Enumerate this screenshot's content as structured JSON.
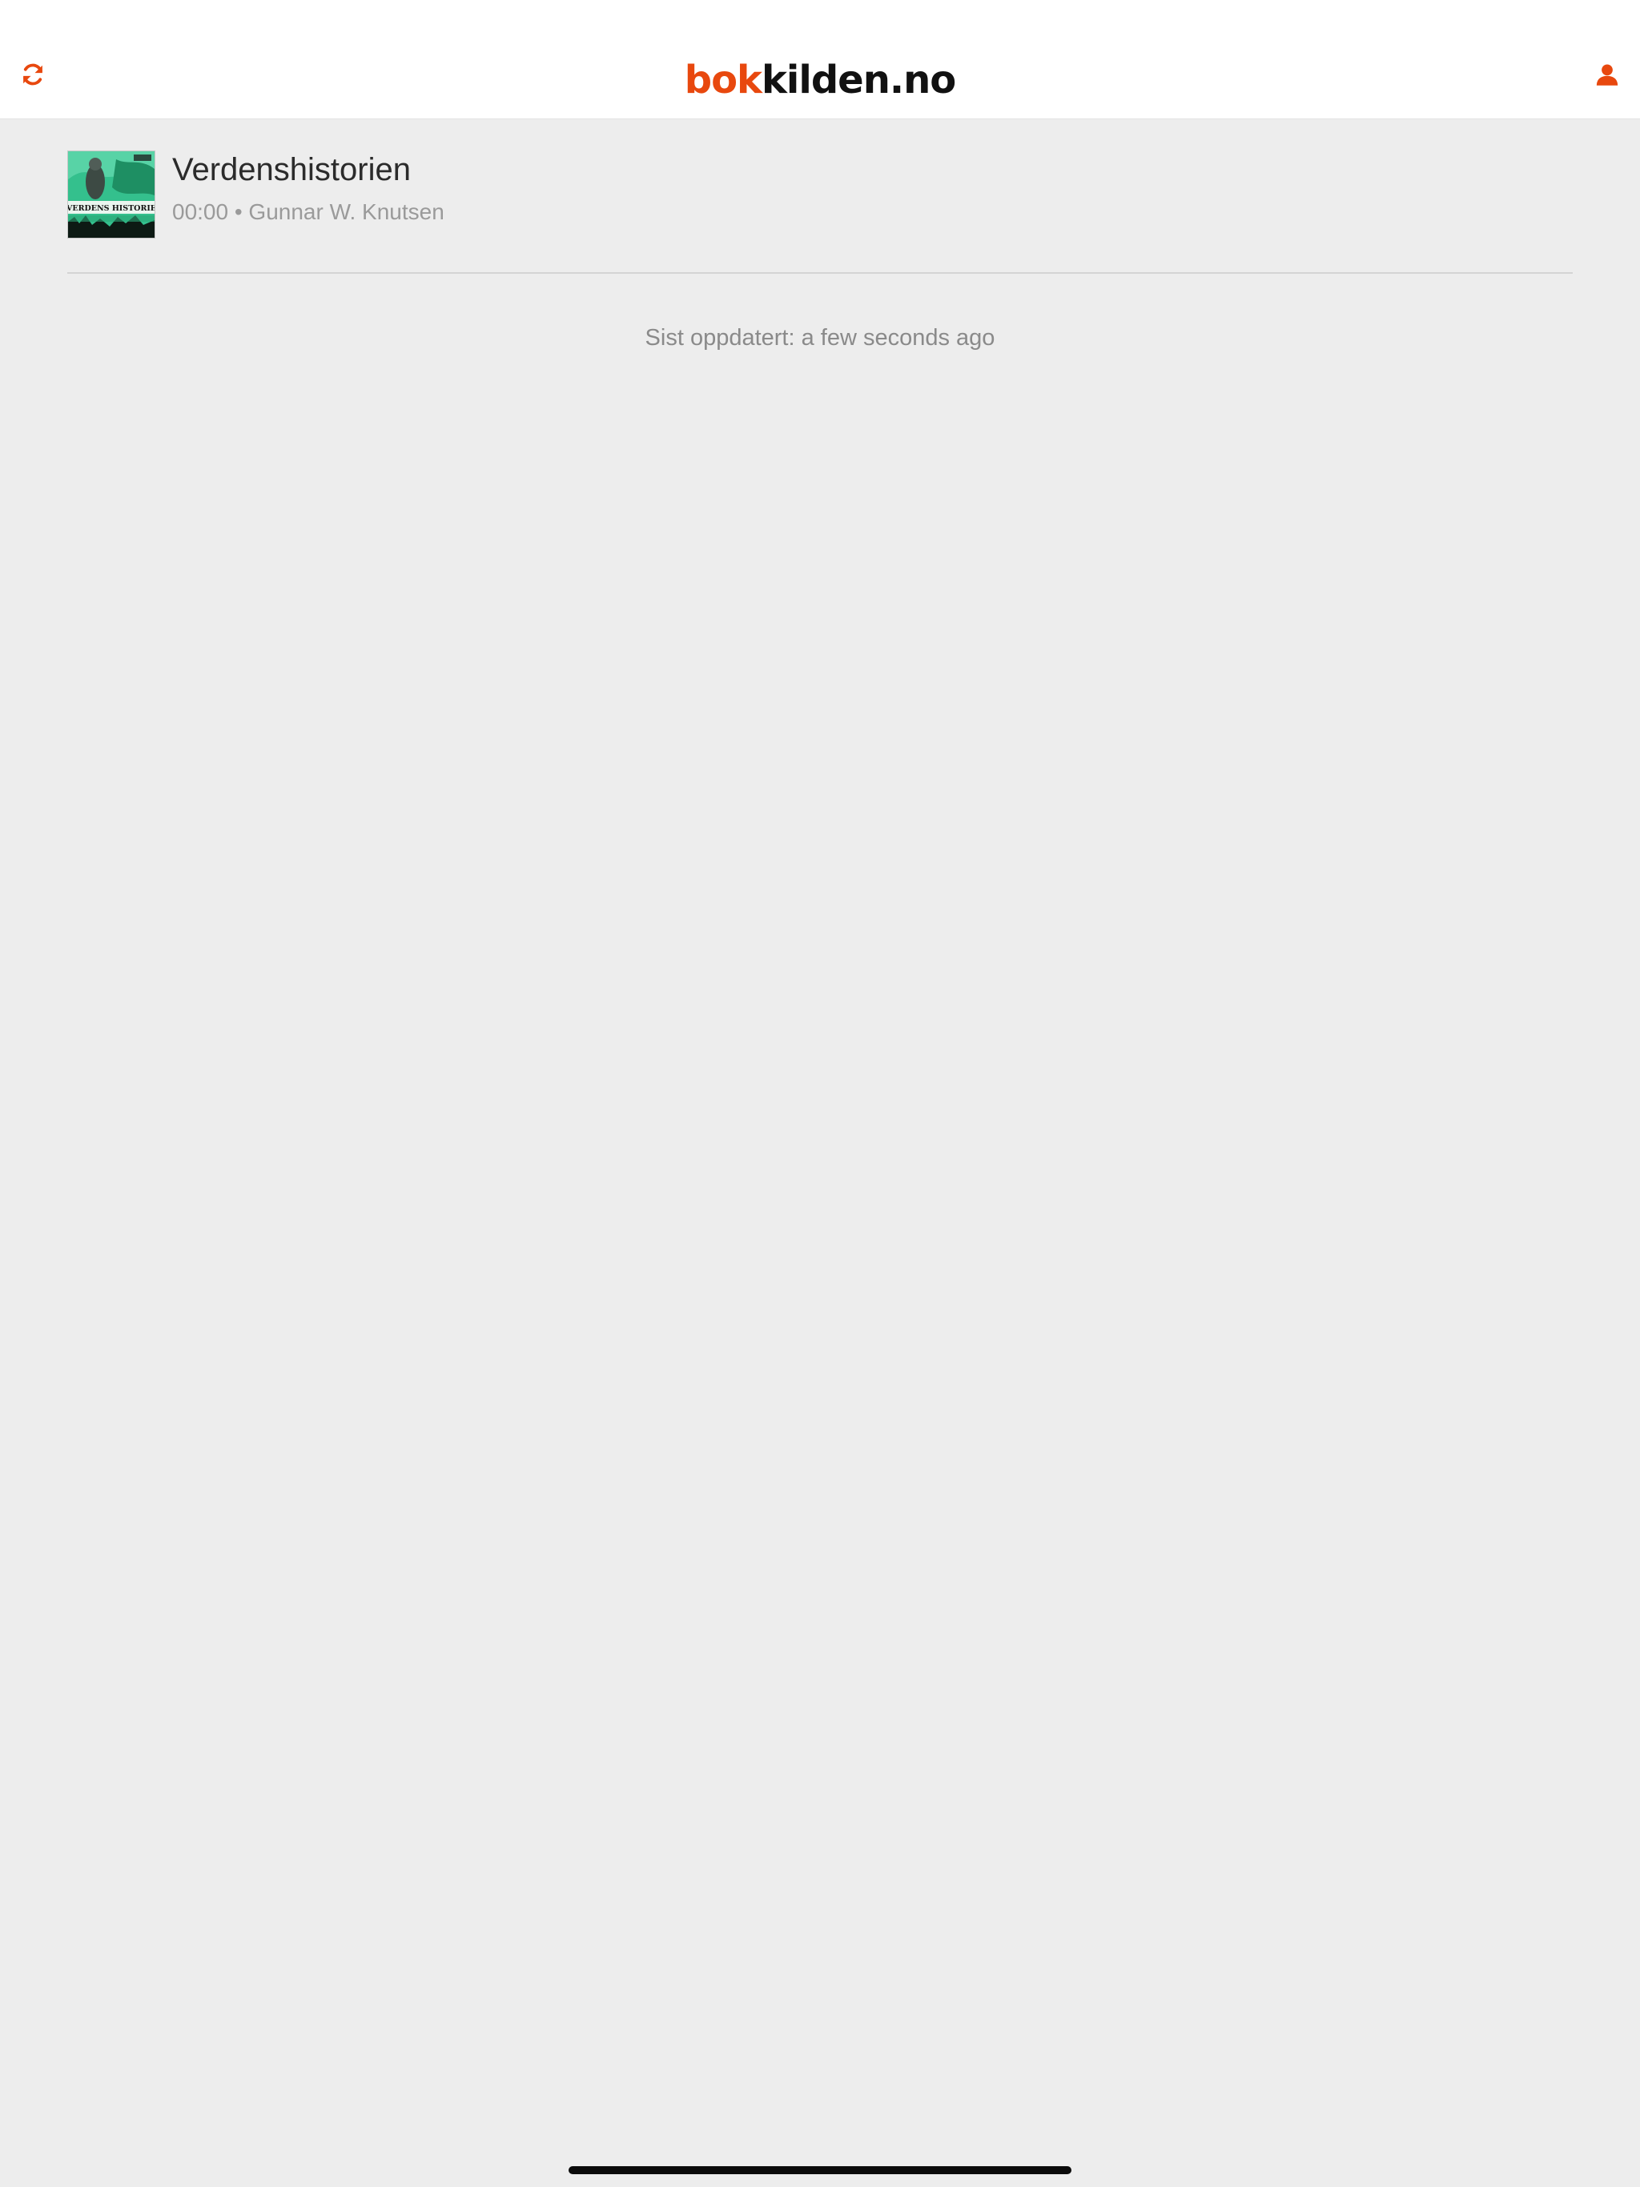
{
  "header": {
    "logo_prefix": "bok",
    "logo_suffix": "kilden.no",
    "refresh_icon": "refresh-icon",
    "account_icon": "user-icon",
    "accent_color": "#e8480e"
  },
  "books": [
    {
      "title": "Verdenshistorien",
      "meta": "00:00 • Gunnar W. Knutsen",
      "cover_text": "VERDENS HISTORIE"
    }
  ],
  "status": {
    "last_updated": "Sist oppdatert: a few seconds ago"
  }
}
